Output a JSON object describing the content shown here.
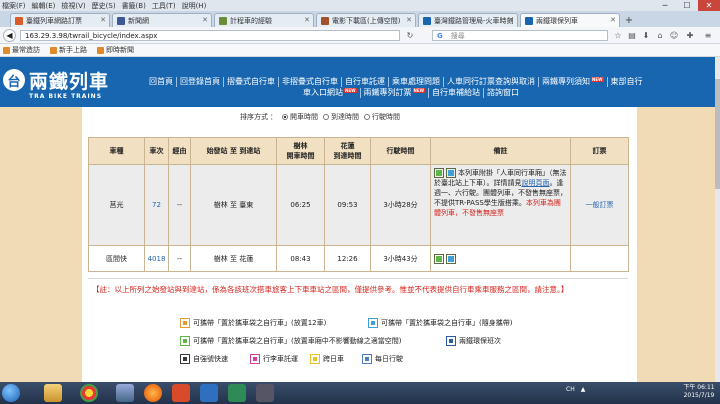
{
  "browser": {
    "menu": [
      "檔案(F)",
      "編輯(E)",
      "檢視(V)",
      "歷史(S)",
      "書籤(B)",
      "工具(T)",
      "說明(H)"
    ],
    "tabs": [
      {
        "label": "臺鐵列車網路訂票",
        "active": false,
        "color": "#d85c2a"
      },
      {
        "label": "新聞網",
        "active": false,
        "color": "#3b5998"
      },
      {
        "label": "計程車的經驗",
        "active": false,
        "color": "#6a8d3a"
      },
      {
        "label": "電影下載區(上傳空間)",
        "active": false,
        "color": "#a0522d"
      },
      {
        "label": "臺灣鐵路管理局-火車時刻",
        "active": false,
        "color": "#1866b0"
      },
      {
        "label": "兩鐵環保列車",
        "active": true,
        "color": "#1866b0"
      }
    ],
    "new_tab": "+",
    "url": "163.29.3.98/twrail_bicycle/index.aspx",
    "search_engine": "G",
    "search_placeholder": "搜尋",
    "bookmarks": [
      "最常造訪",
      "新手上路",
      "即時新聞"
    ]
  },
  "site": {
    "logo_mark": "台",
    "logo_title": "兩鐵列車",
    "logo_subtitle": "TRA BIKE TRAINS",
    "new_badge": "NEW",
    "nav_row1": [
      {
        "label": "回首頁",
        "new": false
      },
      {
        "label": "回登錄首頁",
        "new": false
      },
      {
        "label": "摺疊式自行車",
        "new": false
      },
      {
        "label": "非摺疊式自行車",
        "new": false
      },
      {
        "label": "自行車託運",
        "new": false
      },
      {
        "label": "乘車處理問題",
        "new": false
      },
      {
        "label": "人車同行訂票查詢與取消",
        "new": false
      },
      {
        "label": "兩鐵專列須知",
        "new": true
      },
      {
        "label": "東部自行",
        "new": false
      }
    ],
    "nav_row2": [
      {
        "label": "車入口網站",
        "new": true
      },
      {
        "label": "兩鐵專列訂票",
        "new": true
      },
      {
        "label": "自行車補給站",
        "new": false
      },
      {
        "label": "諮詢窗口",
        "new": false
      }
    ]
  },
  "filter": {
    "prefix": "排序方式",
    "options": [
      {
        "label": "開車時間",
        "checked": true
      },
      {
        "label": "到達時間",
        "checked": false
      },
      {
        "label": "行駛時間",
        "checked": false
      }
    ]
  },
  "table": {
    "headers": [
      "車種",
      "車次",
      "經由",
      "始發站 至 到達站",
      "樹林\n開車時間",
      "花蓮\n到達時間",
      "行駛時間",
      "備註",
      "訂票"
    ],
    "rows": [
      {
        "type": "莒光",
        "train_no": "72",
        "via": "--",
        "route": "樹林 至 臺東",
        "depart": "06:25",
        "arrive": "09:53",
        "duration": "3小時28分",
        "note_a": "本列車附掛「人車同行車廂」（無法於臺北站上下車）。詳情請見",
        "note_link": "說明頁面",
        "note_b": "。逢週一、六行駛。團體列車，不發售無座票，不提供TR-PASS學生版搭乘。",
        "note_red": "本列車為團體列車，不發售無座票",
        "booking": "一般訂票"
      },
      {
        "type": "區間快",
        "train_no": "4018",
        "via": "--",
        "route": "樹林 至 花蓮",
        "depart": "08:43",
        "arrive": "12:26",
        "duration": "3小時43分",
        "booking": ""
      }
    ]
  },
  "notice": "【註：以上所列之始發站與到達站，係為各該班次搭車旅客上下車車站之區間，僅提供參考。惟並不代表提供自行車乘車服務之區間，請注意。】",
  "legend": [
    {
      "label": "可攜帶「置於攜車袋之自行車」(放置12車)",
      "color": "#e69a2e"
    },
    {
      "label": "可攜帶「置於攜車袋之自行車」(隨身攜帶)",
      "color": "#3ea0d6"
    },
    {
      "label": "可攜帶「置於攜車袋之自行車」(放置車廂中不影響動線之適當空間)",
      "color": "#5fb44a"
    },
    {
      "label": "兩鐵環保班次",
      "color": "#2b5c9e"
    },
    {
      "label": "自強號快速",
      "color": "#3a3a3a"
    },
    {
      "label": "行李車託運",
      "color": "#d23fa0"
    },
    {
      "label": "跨日車",
      "color": "#e8c21f"
    },
    {
      "label": "每日行駛",
      "color": "#4a7bc8"
    }
  ],
  "taskbar": {
    "tray_items": [
      "CH",
      "▲"
    ],
    "time": "下午 06:11",
    "date": "2015/7/19"
  }
}
